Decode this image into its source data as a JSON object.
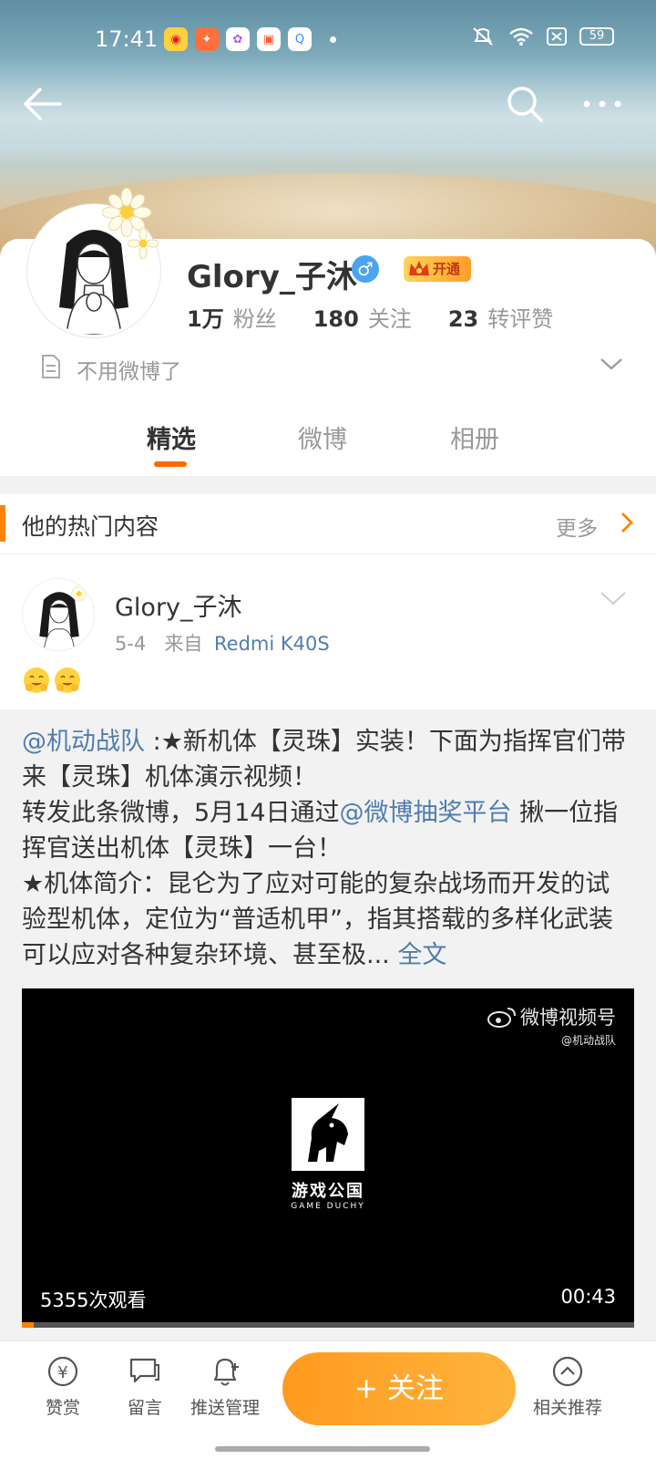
{
  "status_bar": {
    "time": "17:41",
    "battery": "59"
  },
  "profile": {
    "username": "Glory_子沐",
    "gender_symbol": "♂",
    "vip_label": "开通",
    "stats": [
      {
        "value": "1万",
        "label": "粉丝"
      },
      {
        "value": "180",
        "label": "关注"
      },
      {
        "value": "23",
        "label": "转评赞"
      }
    ],
    "bio": "不用微博了"
  },
  "tabs": [
    {
      "label": "精选",
      "active": true
    },
    {
      "label": "微博",
      "active": false
    },
    {
      "label": "相册",
      "active": false
    }
  ],
  "hot_section": {
    "title": "他的热门内容",
    "more": "更多"
  },
  "post": {
    "author": "Glory_子沐",
    "date": "5-4",
    "source_prefix": "来自",
    "source": "Redmi K40S",
    "text": {
      "mention1": "@机动战队",
      "part1": " :★新机体【灵珠】实装！下面为指挥官们带来【灵珠】机体演示视频！",
      "part2": "转发此条微博，5月14日通过",
      "mention2": "@微博抽奖平台",
      "part3": " 揪一位指挥官送出机体【灵珠】一台！",
      "part4": "★机体简介：昆仑为了应对可能的复杂战场而开发的试验型机体，定位为“普适机甲”，指其搭载的多样化武装可以应对各种复杂环境、甚至极...",
      "full": " 全文"
    },
    "video": {
      "watermark_title": "微博视频号",
      "watermark_sub": "@机动战队",
      "logo_name": "游戏公国",
      "logo_sub": "GAME DUCHY",
      "views": "5355次观看",
      "duration": "00:43",
      "progress": 0.02
    }
  },
  "bottom_bar": {
    "reward": "赞赏",
    "message": "留言",
    "push": "推送管理",
    "follow": "+ 关注",
    "related": "相关推荐"
  },
  "colors": {
    "accent": "#ff8200",
    "link": "#507daf",
    "vip": "#ff9d2a"
  }
}
